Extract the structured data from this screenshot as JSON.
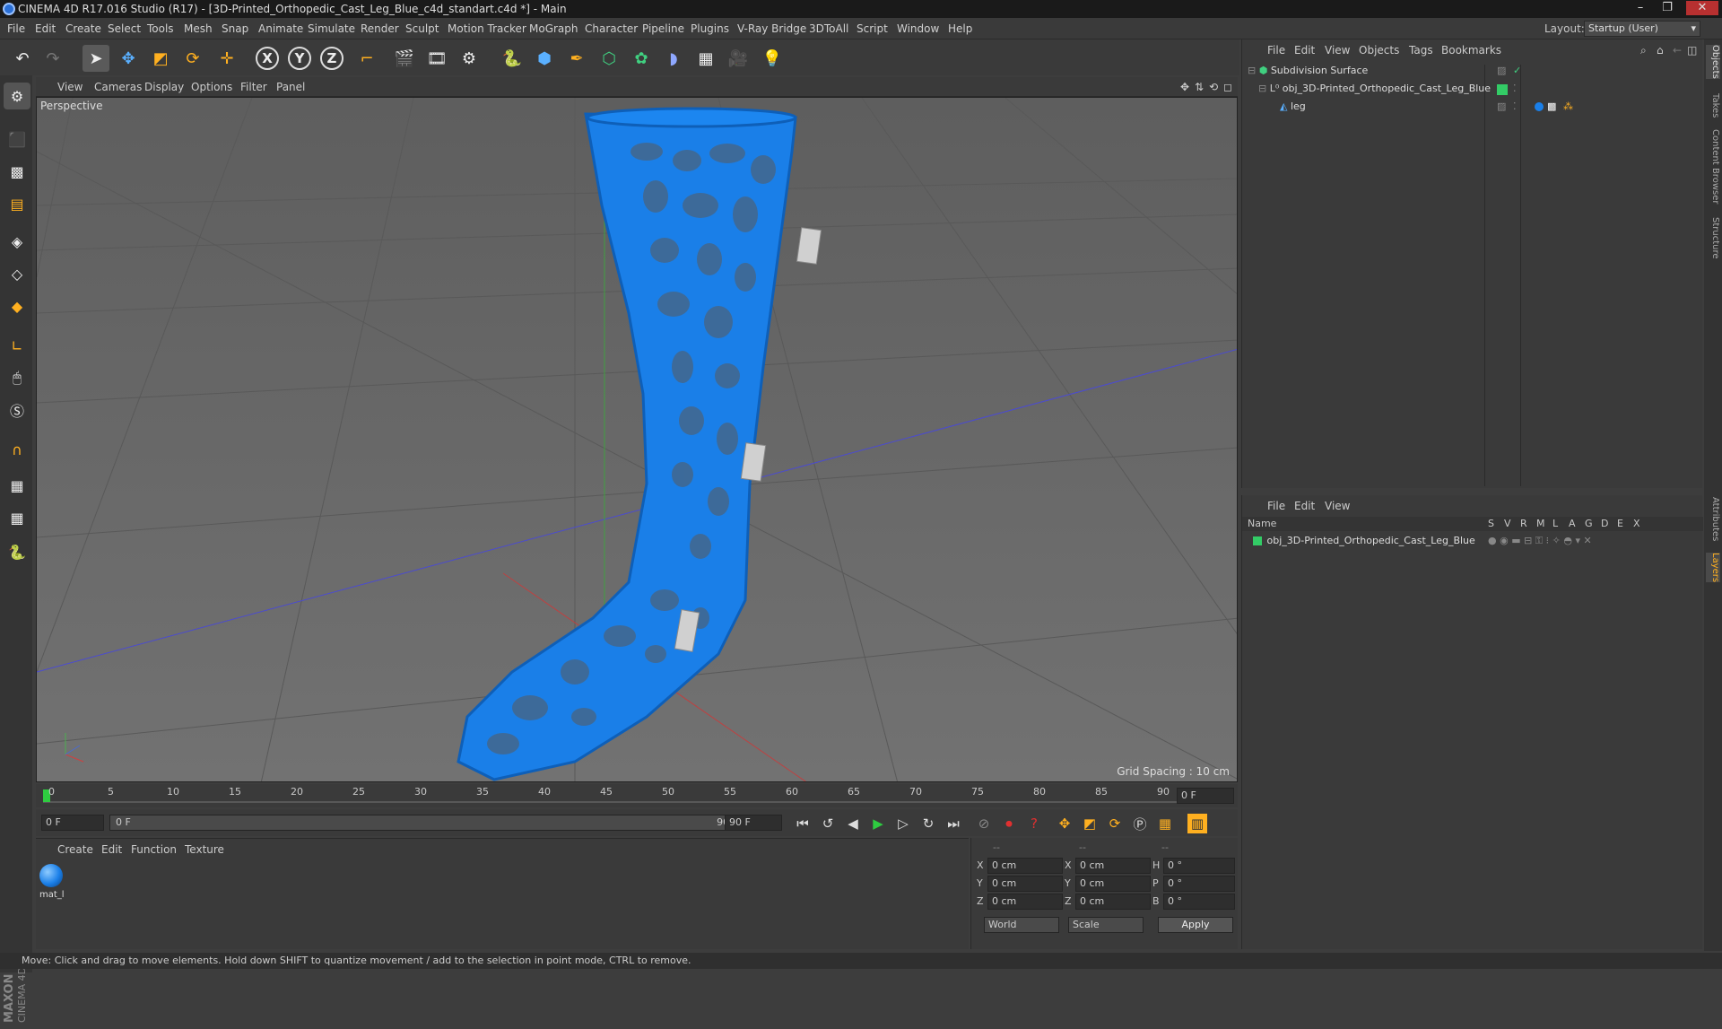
{
  "window": {
    "title": "CINEMA 4D R17.016 Studio (R17) - [3D-Printed_Orthopedic_Cast_Leg_Blue_c4d_standart.c4d *] - Main",
    "controls": [
      "–",
      "❐",
      "✕"
    ]
  },
  "menubar": {
    "items": [
      "File",
      "Edit",
      "Create",
      "Select",
      "Tools",
      "Mesh",
      "Snap",
      "Animate",
      "Simulate",
      "Render",
      "Sculpt",
      "Motion Tracker",
      "MoGraph",
      "Character",
      "Pipeline",
      "Plugins",
      "V-Ray Bridge",
      "3DToAll",
      "Script",
      "Window",
      "Help"
    ],
    "layout_label": "Layout:",
    "layout_value": "Startup (User)"
  },
  "toolbar": {
    "axis_x": "X",
    "axis_y": "Y",
    "axis_z": "Z"
  },
  "viewport_menu": {
    "items": [
      "View",
      "Cameras",
      "Display",
      "Options",
      "Filter",
      "Panel"
    ]
  },
  "viewport": {
    "label": "Perspective",
    "grid_spacing": "Grid Spacing : 10 cm",
    "model_color": "#1a7fe8"
  },
  "timeline": {
    "ticks": [
      "0",
      "5",
      "10",
      "15",
      "20",
      "25",
      "30",
      "35",
      "40",
      "45",
      "50",
      "55",
      "60",
      "65",
      "70",
      "75",
      "80",
      "85",
      "90"
    ],
    "current_frame_field": "0 F"
  },
  "transport": {
    "start_field": "0 F",
    "range_start": "0 F",
    "range_end": "90 F",
    "end_field": "90 F"
  },
  "material_panel": {
    "menu": [
      "Create",
      "Edit",
      "Function",
      "Texture"
    ],
    "material_name": "mat_l"
  },
  "coords": {
    "header": [
      "--",
      "--",
      "--"
    ],
    "rows": [
      {
        "axis": "X",
        "pos": "0 cm",
        "axis2": "X",
        "size": "0 cm",
        "rot_axis": "H",
        "rot": "0 °"
      },
      {
        "axis": "Y",
        "pos": "0 cm",
        "axis2": "Y",
        "size": "0 cm",
        "rot_axis": "P",
        "rot": "0 °"
      },
      {
        "axis": "Z",
        "pos": "0 cm",
        "axis2": "Z",
        "size": "0 cm",
        "rot_axis": "B",
        "rot": "0 °"
      }
    ],
    "mode1": "World",
    "mode2": "Scale",
    "apply": "Apply"
  },
  "object_manager": {
    "menu": [
      "File",
      "Edit",
      "View",
      "Objects",
      "Tags",
      "Bookmarks"
    ],
    "objects": [
      {
        "name": "Subdivision Surface"
      },
      {
        "name": "obj_3D-Printed_Orthopedic_Cast_Leg_Blue"
      },
      {
        "name": "leg"
      }
    ]
  },
  "layer_manager": {
    "menu": [
      "File",
      "Edit",
      "View"
    ],
    "col_name": "Name",
    "cols": [
      "S",
      "V",
      "R",
      "M",
      "L",
      "A",
      "G",
      "D",
      "E",
      "X"
    ],
    "layers": [
      {
        "name": "obj_3D-Printed_Orthopedic_Cast_Leg_Blue",
        "color": "#33cc66"
      }
    ]
  },
  "right_tabs": [
    "Objects",
    "Takes",
    "Content Browser",
    "Structure",
    "Attributes",
    "Layers"
  ],
  "statusbar": {
    "text": "Move: Click and drag to move elements. Hold down SHIFT to quantize movement / add to the selection in point mode, CTRL to remove."
  },
  "branding": {
    "logo_text": "MAXON CINEMA 4D"
  }
}
